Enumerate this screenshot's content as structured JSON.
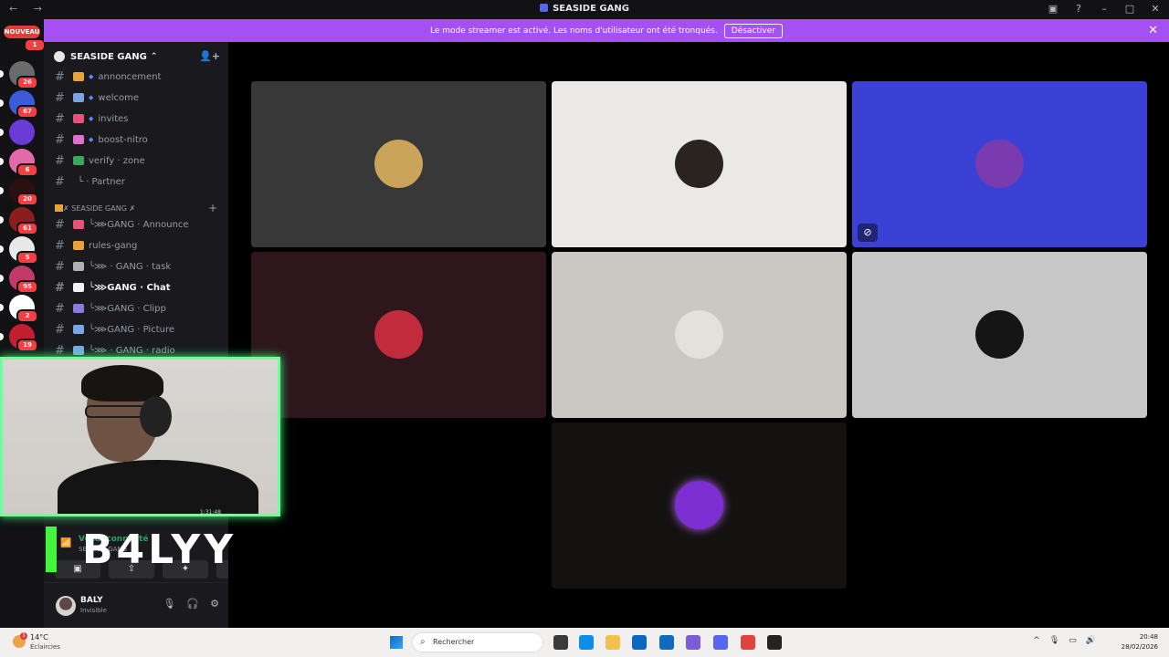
{
  "window": {
    "title": "SEASIDE GANG",
    "back": "←",
    "forward": "→"
  },
  "banner": {
    "message": "Le mode streamer est activé. Les noms d'utilisateur ont été tronqués.",
    "button": "Désactiver"
  },
  "rail": {
    "new_label": "NOUVEAU",
    "new_badge": "1",
    "servers": [
      {
        "badge": "26",
        "color": "#6b6b6b"
      },
      {
        "badge": "67",
        "color": "#3d5bd9"
      },
      {
        "badge": "",
        "color": "#6a3bd6"
      },
      {
        "badge": "6",
        "color": "#e36aa8"
      },
      {
        "badge": "20",
        "color": "#2a1010"
      },
      {
        "badge": "61",
        "color": "#8a1d1d"
      },
      {
        "badge": "5",
        "color": "#e8e8e8"
      },
      {
        "badge": "95",
        "color": "#c23a68"
      },
      {
        "badge": "2",
        "color": "#ffffff"
      },
      {
        "badge": "19",
        "color": "#c01f2f"
      }
    ]
  },
  "sidebar": {
    "server_name": "SEASIDE GANG",
    "channels_top": [
      {
        "label": "annoncement",
        "emoji_color": "#e8a23a",
        "diamond": true
      },
      {
        "label": "welcome",
        "emoji_color": "#7aa6e8",
        "diamond": true
      },
      {
        "label": "invites",
        "emoji_color": "#e8527a",
        "diamond": true
      },
      {
        "label": "boost-nitro",
        "emoji_color": "#e06fd0",
        "diamond": true
      },
      {
        "label": "verify · zone",
        "emoji_color": "#3ba55d",
        "diamond": false
      },
      {
        "label": "└ · Partner",
        "emoji_color": "",
        "diamond": false
      }
    ],
    "category": "✗ SEASIDE GANG ✗",
    "channels_cat": [
      {
        "label": "╰⋙GANG · Announce",
        "emoji_color": "#e8527a",
        "bold": false
      },
      {
        "label": "rules-gang",
        "emoji_color": "#e8a23a",
        "bold": false
      },
      {
        "label": "╰⋙ · GANG · task",
        "emoji_color": "#b0b0b0",
        "bold": false
      },
      {
        "label": "╰⋙GANG · Chat",
        "emoji_color": "#f2f3f5",
        "bold": true
      },
      {
        "label": "╰⋙GANG · Clipp",
        "emoji_color": "#8a7adf",
        "bold": false
      },
      {
        "label": "╰⋙GANG · Picture",
        "emoji_color": "#7aa6e8",
        "bold": false
      },
      {
        "label": "╰⋙ · GANG · radio",
        "emoji_color": "#7aa6e8",
        "bold": false
      }
    ]
  },
  "voice": {
    "status": "Vocal connecté",
    "server": "SEASIDE GANG",
    "buttons": [
      "▣",
      "⇪",
      "✦",
      "⚡"
    ]
  },
  "user": {
    "name": "BALY",
    "status": "Invisible",
    "mic": "🎙",
    "headset": "🎧",
    "settings": "⚙"
  },
  "tiles": [
    {
      "bg": "#383838",
      "pic": "#c9a45a",
      "muted": false
    },
    {
      "bg": "#ebe9e6",
      "pic": "#2b2320",
      "muted": false
    },
    {
      "bg": "#3c41d6",
      "pic": "#7a3ab0",
      "muted": true
    },
    {
      "bg": "#2d171c",
      "pic": "#c22b3b",
      "muted": false
    },
    {
      "bg": "#cbc7c2",
      "pic": "#e4e1dc",
      "muted": false
    },
    {
      "bg": "#c7c7c7",
      "pic": "#151515",
      "muted": false
    },
    {
      "bg": "#141211",
      "pic": "#7d2fd1",
      "muted": false
    }
  ],
  "cam": {
    "stamp": "1:31:48"
  },
  "overlay": {
    "name": "B4LYY"
  },
  "taskbar": {
    "temp": "14°C",
    "weather": "Éclaircies",
    "weather_badge": "1",
    "search": "Rechercher",
    "time": "20:48",
    "date": "28/02/2026",
    "apps": [
      "#3a3a3a",
      "#0c8ee6",
      "#f2c14e",
      "#0a66c2",
      "#0f6cbd",
      "#7b5cd6",
      "#5865f2",
      "#e0443e",
      "#222222"
    ]
  }
}
